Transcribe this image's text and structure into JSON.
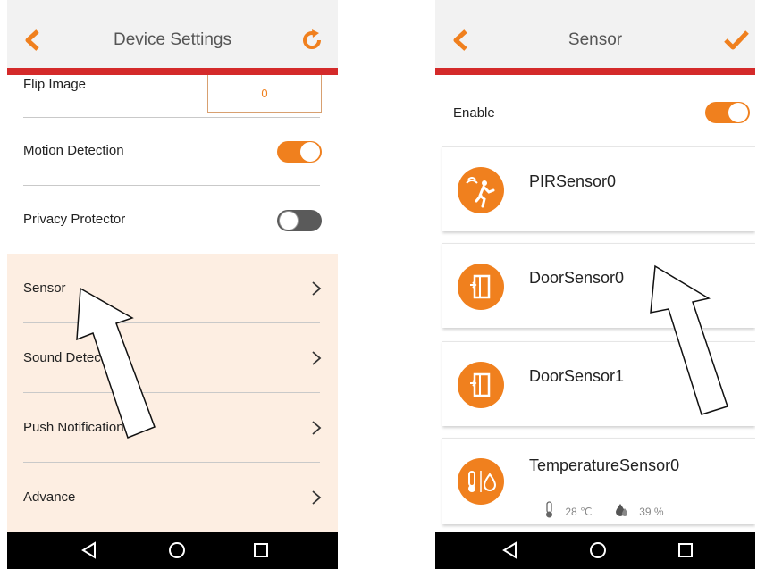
{
  "left_screen": {
    "title": "Device Settings",
    "rows": [
      {
        "label": "Flip Image",
        "value": "0"
      },
      {
        "label": "Motion Detection",
        "toggle": "on"
      },
      {
        "label": "Privacy Protector",
        "toggle": "off"
      },
      {
        "label": "Sensor"
      },
      {
        "label": "Sound Detection"
      },
      {
        "label": "Push Notification"
      },
      {
        "label": "Advance"
      }
    ]
  },
  "right_screen": {
    "title": "Sensor",
    "enable_label": "Enable",
    "enable_toggle": "on",
    "sensors": [
      {
        "name": "PIRSensor0",
        "icon": "motion-sensor-icon"
      },
      {
        "name": "DoorSensor0",
        "icon": "door-sensor-icon"
      },
      {
        "name": "DoorSensor1",
        "icon": "door-sensor-icon"
      },
      {
        "name": "TemperatureSensor0",
        "icon": "temperature-humidity-icon",
        "temperature": "28 ℃",
        "humidity": "39 %"
      }
    ]
  },
  "colors": {
    "accent": "#f0801e",
    "header_line": "#d42a2a",
    "highlight_bg": "#fdeee2",
    "navbar": "#000000"
  }
}
